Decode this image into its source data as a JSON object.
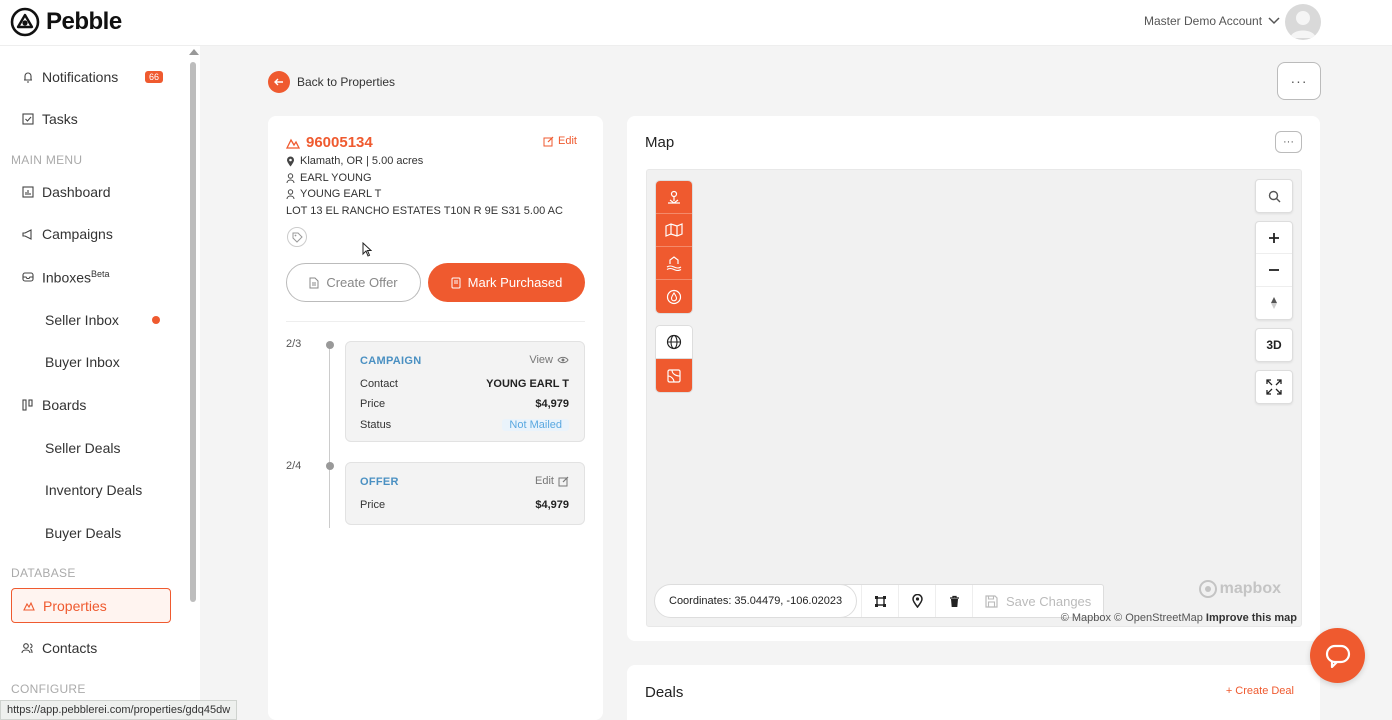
{
  "app": {
    "logo_text": "Pebble",
    "account_name": "Master Demo Account",
    "status_url": "https://app.pebblerei.com/properties/gdq45dw"
  },
  "sidebar": {
    "notifications": {
      "label": "Notifications",
      "badge": "66"
    },
    "tasks": "Tasks",
    "main_menu_heading": "MAIN MENU",
    "dashboard": "Dashboard",
    "campaigns": "Campaigns",
    "inboxes": {
      "label": "Inboxes",
      "sup": "Beta"
    },
    "seller_inbox": "Seller Inbox",
    "buyer_inbox": "Buyer Inbox",
    "boards": "Boards",
    "seller_deals": "Seller Deals",
    "inventory_deals": "Inventory Deals",
    "buyer_deals": "Buyer Deals",
    "database_heading": "DATABASE",
    "properties": "Properties",
    "contacts": "Contacts",
    "configure_heading": "CONFIGURE"
  },
  "header": {
    "back_label": "Back to Properties",
    "more_label": "···"
  },
  "property": {
    "id": "96005134",
    "edit_label": "Edit",
    "location": "Klamath, OR | 5.00 acres",
    "owner_1": "EARL YOUNG",
    "owner_2": "YOUNG EARL T",
    "legal": "LOT 13 EL RANCHO ESTATES T10N R 9E S31 5.00 AC",
    "create_offer_label": "Create Offer",
    "mark_purchased_label": "Mark Purchased"
  },
  "timeline": [
    {
      "step": "2/3",
      "title": "CAMPAIGN",
      "action": "View",
      "rows": [
        {
          "key": "Contact",
          "value": "YOUNG EARL T"
        },
        {
          "key": "Price",
          "value": "$4,979"
        },
        {
          "key": "Status",
          "value": "Not Mailed"
        }
      ]
    },
    {
      "step": "2/4",
      "title": "OFFER",
      "action": "Edit",
      "rows": [
        {
          "key": "Price",
          "value": "$4,979"
        }
      ]
    }
  ],
  "map": {
    "title": "Map",
    "more_label": "···",
    "coordinates": "Coordinates: 35.04479, -106.02023",
    "save_changes": "Save Changes",
    "three_d_label": "3D",
    "brand": "mapbox",
    "attribution_1": "© Mapbox © OpenStreetMap",
    "attribution_2": "Improve this map"
  },
  "deals": {
    "title": "Deals",
    "create_label": "+ Create Deal"
  },
  "colors": {
    "accent": "#ef5a2f",
    "link_blue": "#4a90c2"
  }
}
